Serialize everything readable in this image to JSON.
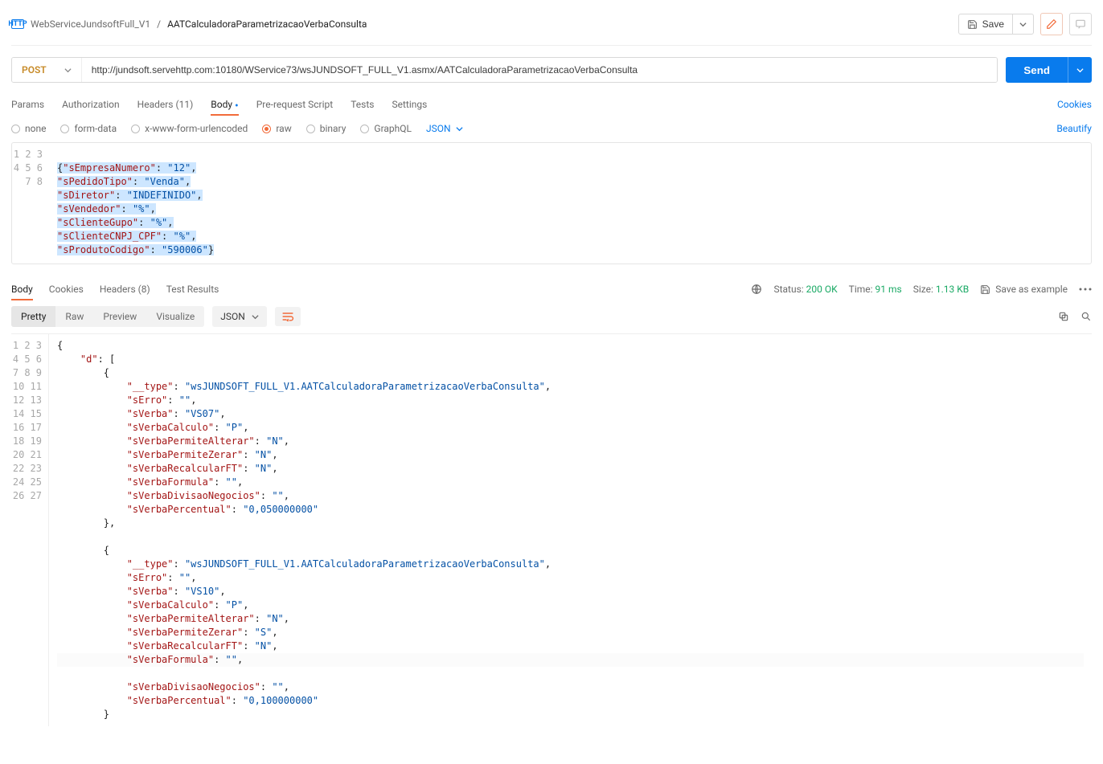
{
  "breadcrumb": {
    "parent": "WebServiceJundsoftFull_V1",
    "name": "AATCalculadoraParametrizacaoVerbaConsulta"
  },
  "toolbar": {
    "save_label": "Save"
  },
  "request": {
    "method": "POST",
    "url": "http://jundsoft.servehttp.com:10180/WService73/wsJUNDSOFT_FULL_V1.asmx/AATCalculadoraParametrizacaoVerbaConsulta",
    "send_label": "Send"
  },
  "tabs": {
    "params": "Params",
    "auth": "Authorization",
    "headers": "Headers (11)",
    "body": "Body",
    "prereq": "Pre-request Script",
    "tests": "Tests",
    "settings": "Settings",
    "cookies": "Cookies"
  },
  "body_types": {
    "none": "none",
    "formdata": "form-data",
    "xwww": "x-www-form-urlencoded",
    "raw": "raw",
    "binary": "binary",
    "graphql": "GraphQL",
    "raw_type": "JSON",
    "beautify": "Beautify"
  },
  "request_body": {
    "lines": [
      "",
      "{\"sEmpresaNumero\": \"12\",",
      "\"sPedidoTipo\": \"Venda\",",
      "\"sDiretor\": \"INDEFINIDO\",",
      "\"sVendedor\": \"%\",",
      "\"sClienteGupo\": \"%\",",
      "\"sClienteCNPJ_CPF\": \"%\",",
      "\"sProdutoCodigo\": \"590006\"}"
    ]
  },
  "response": {
    "tabs": {
      "body": "Body",
      "cookies": "Cookies",
      "headers": "Headers (8)",
      "test_results": "Test Results"
    },
    "status_label": "Status:",
    "status_value": "200 OK",
    "time_label": "Time:",
    "time_value": "91 ms",
    "size_label": "Size:",
    "size_value": "1.13 KB",
    "save_example": "Save as example",
    "view": {
      "pretty": "Pretty",
      "raw": "Raw",
      "preview": "Preview",
      "visualize": "Visualize",
      "lang": "JSON"
    },
    "body_json": {
      "d": [
        {
          "__type": "wsJUNDSOFT_FULL_V1.AATCalculadoraParametrizacaoVerbaConsulta",
          "sErro": "",
          "sVerba": "VS07",
          "sVerbaCalculo": "P",
          "sVerbaPermiteAlterar": "N",
          "sVerbaPermiteZerar": "N",
          "sVerbaRecalcularFT": "N",
          "sVerbaFormula": "",
          "sVerbaDivisaoNegocios": "",
          "sVerbaPercentual": "0,050000000"
        },
        {
          "__type": "wsJUNDSOFT_FULL_V1.AATCalculadoraParametrizacaoVerbaConsulta",
          "sErro": "",
          "sVerba": "VS10",
          "sVerbaCalculo": "P",
          "sVerbaPermiteAlterar": "N",
          "sVerbaPermiteZerar": "S",
          "sVerbaRecalcularFT": "N",
          "sVerbaFormula": "",
          "sVerbaDivisaoNegocios": "",
          "sVerbaPercentual": "0,100000000"
        }
      ]
    }
  }
}
